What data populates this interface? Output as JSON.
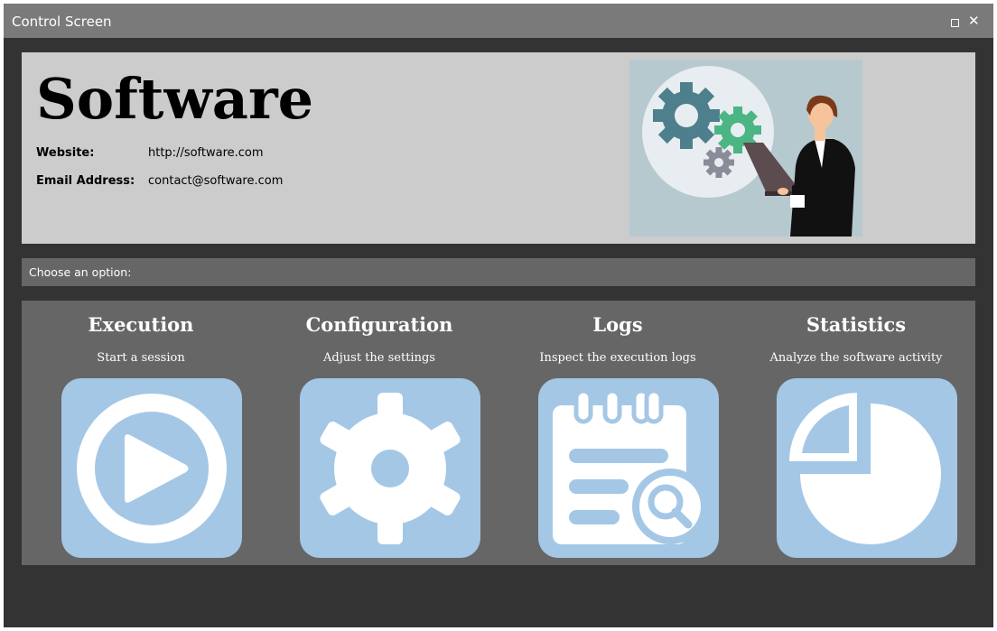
{
  "window": {
    "title": "Control Screen",
    "maximize_icon": "maximize-icon",
    "close_label": "✕"
  },
  "header": {
    "brand": "Software",
    "website_label": "Website:",
    "website_value": "http://software.com",
    "email_label": "Email Address:",
    "email_value": "contact@software.com",
    "illustration": "business-woman-with-laptop-and-gears"
  },
  "prompt": "Choose an option:",
  "options": [
    {
      "title": "Execution",
      "description": "Start a session",
      "icon": "play-icon"
    },
    {
      "title": "Configuration",
      "description": "Adjust the settings",
      "icon": "gear-icon"
    },
    {
      "title": "Logs",
      "description": "Inspect the execution logs",
      "icon": "log-notepad-icon"
    },
    {
      "title": "Statistics",
      "description": "Analyze the software activity",
      "icon": "pie-chart-icon"
    }
  ],
  "colors": {
    "titlebar": "#7a7a7a",
    "window_bg": "#333333",
    "header_bg": "#cccccc",
    "panel_bg": "#666666",
    "tile": "#a4c7e6"
  }
}
